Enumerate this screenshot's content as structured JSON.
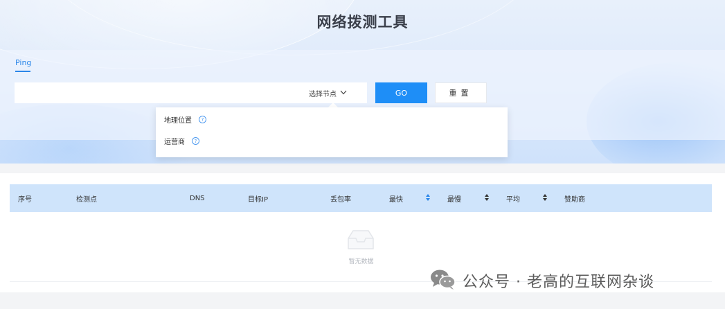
{
  "header": {
    "title": "网络拨测工具"
  },
  "tabs": [
    {
      "label": "Ping",
      "active": true
    }
  ],
  "query": {
    "input_value": "",
    "node_select_label": "选择节点",
    "go_label": "GO",
    "reset_label": "重置"
  },
  "node_dropdown": {
    "items": [
      {
        "label": "地理位置",
        "icon": "help-circle-icon"
      },
      {
        "label": "运营商",
        "icon": "help-circle-icon"
      }
    ]
  },
  "table": {
    "columns": [
      "序号",
      "检测点",
      "DNS",
      "目标IP",
      "丢包率",
      "最快",
      "最慢",
      "平均",
      "赞助商"
    ],
    "sortable_columns": [
      "最快",
      "最慢",
      "平均"
    ],
    "rows": [],
    "empty_text": "暂无数据"
  },
  "watermark": {
    "text": "公众号 · 老高的互联网杂谈",
    "icon": "wechat-icon"
  },
  "colors": {
    "primary": "#1e8ef7",
    "header_bg": "#cfe4fb",
    "tab_active": "#2b86e8"
  }
}
